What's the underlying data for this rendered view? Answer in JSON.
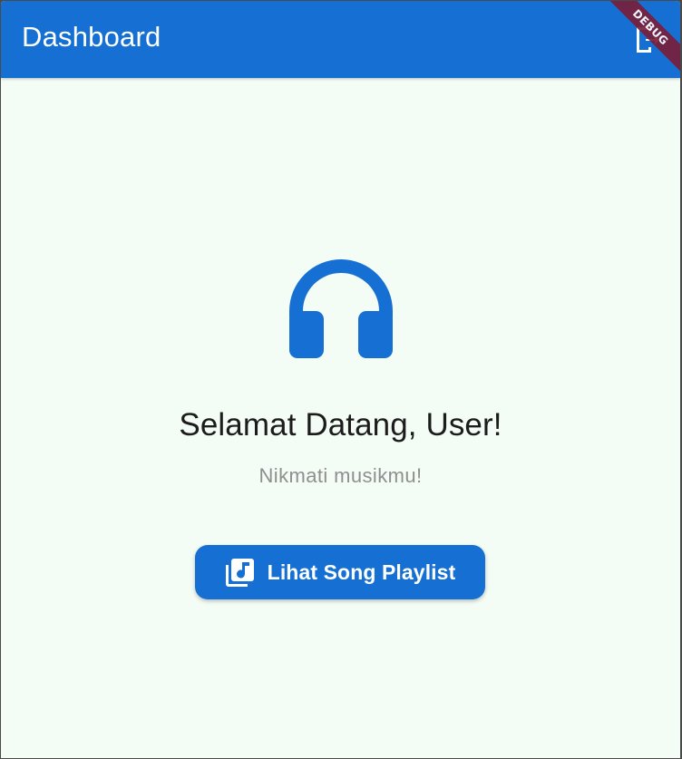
{
  "appbar": {
    "title": "Dashboard",
    "action_icon": "logout-icon",
    "debug_banner": "DEBUG"
  },
  "main": {
    "hero_icon": "headphones-icon",
    "welcome_title": "Selamat Datang, User!",
    "welcome_subtitle": "Nikmati musikmu!",
    "playlist_button": {
      "icon": "library-music-icon",
      "label": "Lihat Song Playlist"
    }
  },
  "colors": {
    "primary": "#1670d4",
    "background": "#f3fdf6",
    "title_text": "#1c1c1c",
    "subtitle_text": "#8f8f8f",
    "debug_banner": "#7a1f3a"
  }
}
